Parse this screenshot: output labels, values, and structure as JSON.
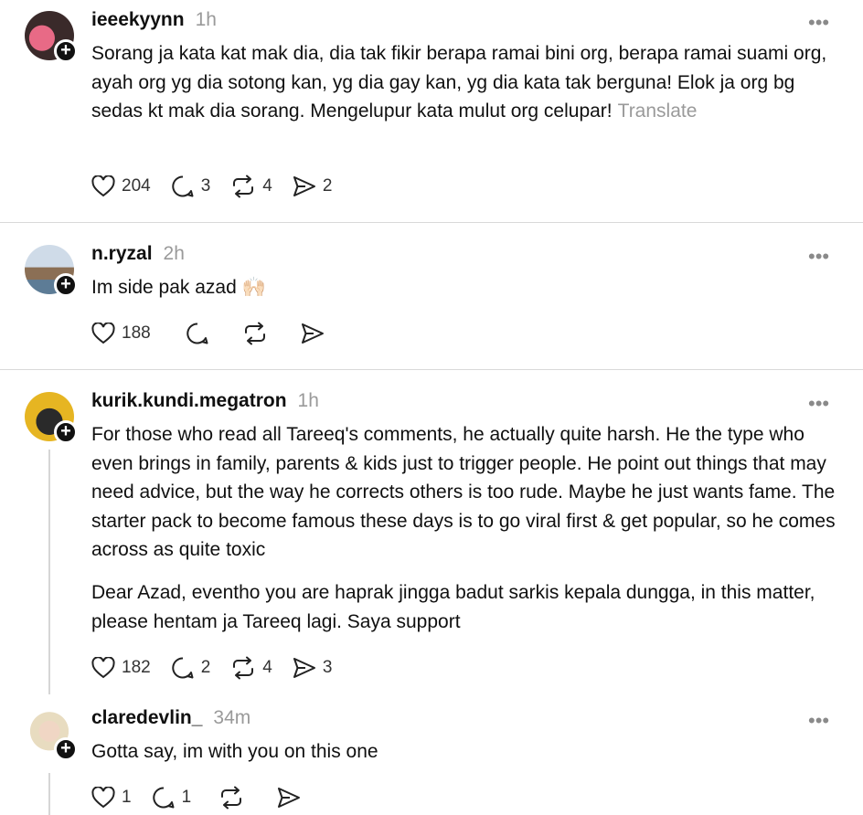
{
  "posts": [
    {
      "username": "ieeekyynn",
      "time": "1h",
      "text": "Sorang ja kata kat mak dia, dia tak fikir berapa ramai bini org, berapa ramai suami org, ayah org yg dia sotong kan, yg dia gay kan, yg dia kata tak berguna! Elok ja org bg sedas kt mak dia sorang. Mengelupur kata mulut org celupar!",
      "translate": "Translate",
      "likes": "204",
      "replies": "3",
      "reposts": "4",
      "shares": "2"
    },
    {
      "username": "n.ryzal",
      "time": "2h",
      "text": "Im side pak azad",
      "emoji": "🙌🏻",
      "likes": "188",
      "replies": "",
      "reposts": "",
      "shares": ""
    },
    {
      "username": "kurik.kundi.megatron",
      "time": "1h",
      "text": "For those who read all Tareeq's comments, he actually quite harsh. He the type who even brings in family, parents & kids just to trigger people. He point out things that may need advice, but the way he corrects others is too rude. Maybe he just wants fame. The starter pack to become famous these days is to go viral first & get popular, so he comes across as quite toxic",
      "text2": "Dear Azad, eventho you are haprak jingga badut sarkis kepala dungga, in this matter, please hentam ja Tareeq lagi. Saya support",
      "likes": "182",
      "replies": "2",
      "reposts": "4",
      "shares": "3"
    },
    {
      "username": "claredevlin_",
      "time": "34m",
      "text": "Gotta say, im with you on this one",
      "likes": "1",
      "replies": "1",
      "reposts": "",
      "shares": ""
    }
  ],
  "icons": {
    "like": "heart-icon",
    "reply": "comment-icon",
    "repost": "repost-icon",
    "share": "send-icon",
    "more": "more-icon",
    "follow": "plus-icon"
  }
}
